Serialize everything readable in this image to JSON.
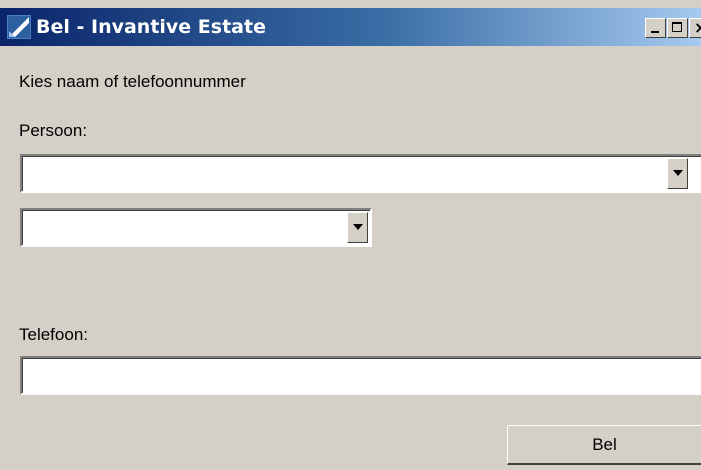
{
  "window": {
    "title": "Bel - Invantive Estate",
    "app_icon": "invantive-app-icon",
    "controls": {
      "minimize": "minimize-icon",
      "maximize": "maximize-icon",
      "close": "close-icon",
      "close_glyph": "×"
    }
  },
  "form": {
    "instruction": "Kies naam of telefoonnummer",
    "person_label": "Persoon:",
    "person_value": "",
    "second_value": "",
    "phone_label": "Telefoon:",
    "phone_value": ""
  },
  "actions": {
    "call_label": "Bel"
  },
  "colors": {
    "face": "#d4d0c8",
    "titlebar_start": "#0a246a",
    "titlebar_end": "#a6caf0"
  }
}
